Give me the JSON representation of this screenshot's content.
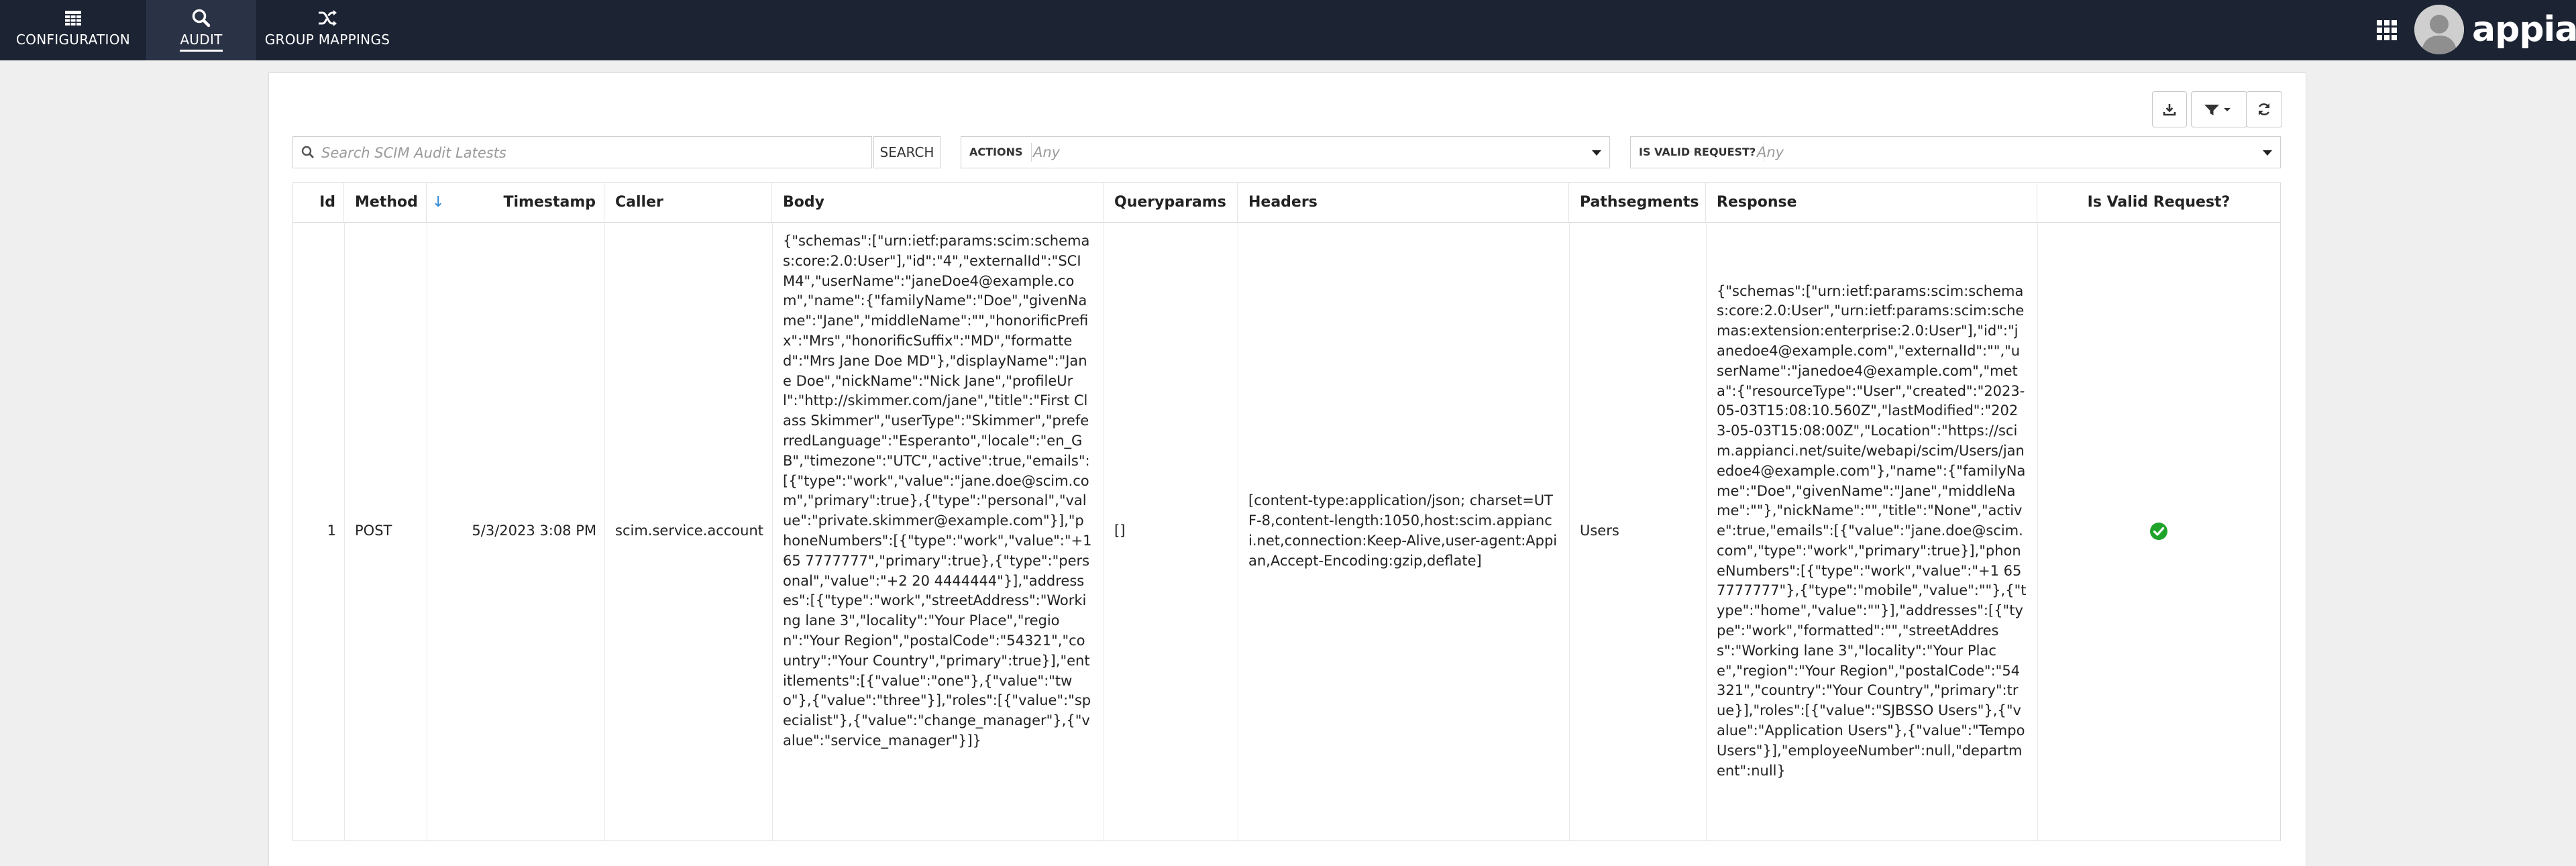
{
  "nav": {
    "tabs": [
      {
        "label": "CONFIGURATION",
        "icon": "table-icon"
      },
      {
        "label": "AUDIT",
        "icon": "search-icon",
        "active": true
      },
      {
        "label": "GROUP MAPPINGS",
        "icon": "shuffle-icon"
      }
    ],
    "logo_text": "appian"
  },
  "toolbar": {
    "download_icon": "download-icon",
    "filter_icon": "filter-icon",
    "refresh_icon": "refresh-icon"
  },
  "search": {
    "placeholder": "Search SCIM Audit Latests",
    "value": "",
    "button_label": "SEARCH"
  },
  "filters": [
    {
      "label": "ACTIONS",
      "value": "Any"
    },
    {
      "label": "IS VALID REQUEST?",
      "value": "Any"
    }
  ],
  "table": {
    "columns": [
      "Id",
      "Method",
      "Timestamp",
      "Caller",
      "Body",
      "Queryparams",
      "Headers",
      "Pathsegments",
      "Response",
      "Is Valid Request?"
    ],
    "sort_indicator": "↓",
    "rows": [
      {
        "id": "1",
        "method": "POST",
        "timestamp": "5/3/2023 3:08 PM",
        "caller": "scim.service.account",
        "body": "{\"schemas\":[\"urn:ietf:params:scim:schemas:core:2.0:User\"],\"id\":\"4\",\"externalId\":\"SCIM4\",\"userName\":\"janeDoe4@example.com\",\"name\":{\"familyName\":\"Doe\",\"givenName\":\"Jane\",\"middleName\":\"\",\"honorificPrefix\":\"Mrs\",\"honorificSuffix\":\"MD\",\"formatted\":\"Mrs Jane Doe MD\"},\"displayName\":\"Jane Doe\",\"nickName\":\"Nick Jane\",\"profileUrl\":\"http://skimmer.com/jane\",\"title\":\"First Class Skimmer\",\"userType\":\"Skimmer\",\"preferredLanguage\":\"Esperanto\",\"locale\":\"en_GB\",\"timezone\":\"UTC\",\"active\":true,\"emails\":[{\"type\":\"work\",\"value\":\"jane.doe@scim.com\",\"primary\":true},{\"type\":\"personal\",\"value\":\"private.skimmer@example.com\"}],\"phoneNumbers\":[{\"type\":\"work\",\"value\":\"+1 65 7777777\",\"primary\":true},{\"type\":\"personal\",\"value\":\"+2 20 4444444\"}],\"addresses\":[{\"type\":\"work\",\"streetAddress\":\"Working lane 3\",\"locality\":\"Your Place\",\"region\":\"Your Region\",\"postalCode\":\"54321\",\"country\":\"Your Country\",\"primary\":true}],\"entitlements\":[{\"value\":\"one\"},{\"value\":\"two\"},{\"value\":\"three\"}],\"roles\":[{\"value\":\"specialist\"},{\"value\":\"change_manager\"},{\"value\":\"service_manager\"}]}",
        "queryparams": "[]",
        "headers": "[content-type:application/json; charset=UTF-8,content-length:1050,host:scim.appianci.net,connection:Keep-Alive,user-agent:Appian,Accept-Encoding:gzip,deflate]",
        "pathsegments": "Users",
        "response": "{\"schemas\":[\"urn:ietf:params:scim:schemas:core:2.0:User\",\"urn:ietf:params:scim:schemas:extension:enterprise:2.0:User\"],\"id\":\"janedoe4@example.com\",\"externalId\":\"\",\"userName\":\"janedoe4@example.com\",\"meta\":{\"resourceType\":\"User\",\"created\":\"2023-05-03T15:08:10.560Z\",\"lastModified\":\"2023-05-03T15:08:00Z\",\"Location\":\"https://scim.appianci.net/suite/webapi/scim/Users/janedoe4@example.com\"},\"name\":{\"familyName\":\"Doe\",\"givenName\":\"Jane\",\"middleName\":\"\"},\"nickName\":\"\",\"title\":\"None\",\"active\":true,\"emails\":[{\"value\":\"jane.doe@scim.com\",\"type\":\"work\",\"primary\":true}],\"phoneNumbers\":[{\"type\":\"work\",\"value\":\"+1 65 7777777\"},{\"type\":\"mobile\",\"value\":\"\"},{\"type\":\"home\",\"value\":\"\"}],\"addresses\":[{\"type\":\"work\",\"formatted\":\"\",\"streetAddress\":\"Working lane 3\",\"locality\":\"Your Place\",\"region\":\"Your Region\",\"postalCode\":\"54321\",\"country\":\"Your Country\",\"primary\":true}],\"roles\":[{\"value\":\"SJBSSO Users\"},{\"value\":\"Application Users\"},{\"value\":\"Tempo Users\"}],\"employeeNumber\":null,\"department\":null}",
        "is_valid_request": "check-circle-icon"
      }
    ]
  },
  "colors": {
    "nav_bg": "#1c2333",
    "accent_blue": "#2e86d6",
    "valid_green": "#1fa32a"
  }
}
